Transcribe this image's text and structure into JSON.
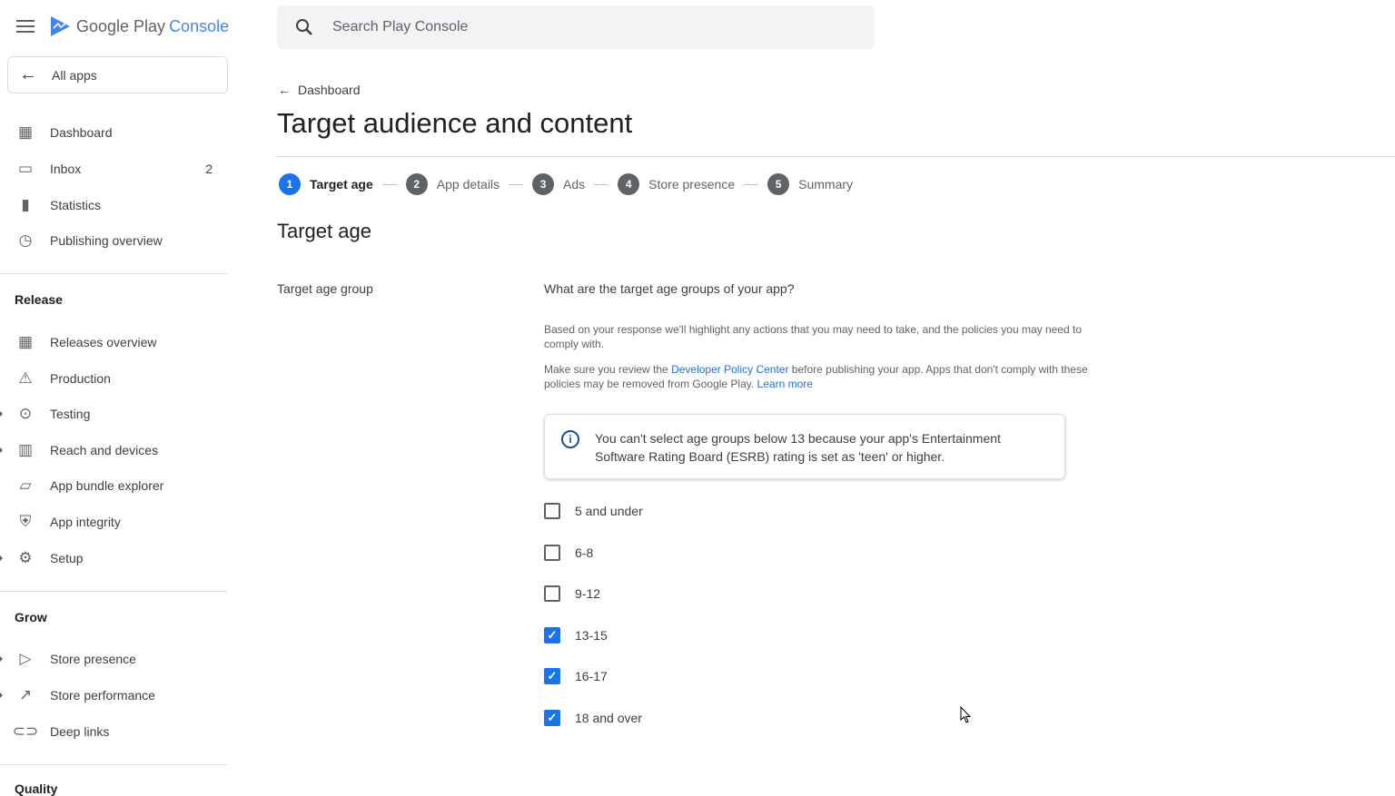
{
  "app": {
    "logo_text": "Google Play",
    "logo_accent": "Console",
    "brand_color": "#1a73e8"
  },
  "sidebar": {
    "all_apps": "All apps",
    "items": [
      {
        "label": "Dashboard",
        "icon": "dashboard-icon"
      },
      {
        "label": "Inbox",
        "icon": "inbox-icon",
        "count": "2"
      },
      {
        "label": "Statistics",
        "icon": "bar-chart-icon"
      },
      {
        "label": "Publishing overview",
        "icon": "publishing-clock-icon"
      }
    ],
    "release_title": "Release",
    "release": [
      {
        "label": "Releases overview",
        "icon": "releases-icon"
      },
      {
        "label": "Production",
        "icon": "production-icon"
      },
      {
        "label": "Testing",
        "icon": "testing-icon"
      },
      {
        "label": "Reach and devices",
        "icon": "reach-icon"
      },
      {
        "label": "App bundle explorer",
        "icon": "bundle-icon"
      },
      {
        "label": "App integrity",
        "icon": "shield-icon"
      },
      {
        "label": "Setup",
        "icon": "gear-icon"
      }
    ],
    "grow_title": "Grow",
    "grow": [
      {
        "label": "Store presence",
        "icon": "play-icon"
      },
      {
        "label": "Store performance",
        "icon": "trending-icon"
      },
      {
        "label": "Deep links",
        "icon": "link-icon"
      }
    ],
    "quality_title": "Quality"
  },
  "search": {
    "placeholder": "Search Play Console"
  },
  "breadcrumb": "Dashboard",
  "page_title": "Target audience and content",
  "steps": [
    {
      "n": "1",
      "label": "Target age",
      "active": true
    },
    {
      "n": "2",
      "label": "App details"
    },
    {
      "n": "3",
      "label": "Ads"
    },
    {
      "n": "4",
      "label": "Store presence"
    },
    {
      "n": "5",
      "label": "Summary"
    }
  ],
  "section_title": "Target age",
  "field_label": "Target age group",
  "question": "What are the target age groups of your app?",
  "desc1": "Based on your response we'll highlight any actions that you may need to take, and the policies you may need to comply with.",
  "desc2_pre": "Make sure you review the ",
  "desc2_link": "Developer Policy Center",
  "desc2_post": " before publishing your app. Apps that don't comply with these policies may be removed from Google Play. ",
  "desc2_learn": "Learn more",
  "info": "You can't select age groups below 13 because your app's Entertainment Software Rating Board (ESRB) rating is set as 'teen' or higher.",
  "options": [
    {
      "label": "5 and under",
      "checked": false
    },
    {
      "label": "6-8",
      "checked": false
    },
    {
      "label": "9-12",
      "checked": false
    },
    {
      "label": "13-15",
      "checked": true
    },
    {
      "label": "16-17",
      "checked": true
    },
    {
      "label": "18 and over",
      "checked": true
    }
  ]
}
